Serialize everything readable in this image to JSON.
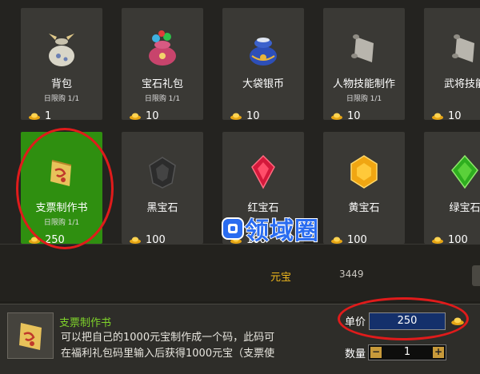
{
  "shop": {
    "items": [
      {
        "name": "背包",
        "limit": "日限购 1/1",
        "price": "1",
        "icon": "bag-icon",
        "selected": false
      },
      {
        "name": "宝石礼包",
        "limit": "日限购 1/1",
        "price": "10",
        "icon": "gem-gift-pack-icon",
        "selected": false
      },
      {
        "name": "大袋银币",
        "limit": "",
        "price": "10",
        "icon": "silver-coin-bag-icon",
        "selected": false
      },
      {
        "name": "人物技能制作",
        "limit": "日限购 1/1",
        "price": "10",
        "icon": "skill-scroll-icon",
        "selected": false
      },
      {
        "name": "武将技能",
        "limit": "",
        "price": "10",
        "icon": "skill-scroll-icon",
        "selected": false
      },
      {
        "name": "支票制作书",
        "limit": "日限购 1/1",
        "price": "250",
        "icon": "check-book-scroll-icon",
        "selected": true
      },
      {
        "name": "黑宝石",
        "limit": "",
        "price": "100",
        "icon": "black-gem-icon",
        "selected": false
      },
      {
        "name": "红宝石",
        "limit": "",
        "price": "100",
        "icon": "red-gem-icon",
        "selected": false
      },
      {
        "name": "黄宝石",
        "limit": "",
        "price": "100",
        "icon": "yellow-gem-icon",
        "selected": false
      },
      {
        "name": "绿宝石",
        "limit": "",
        "price": "100",
        "icon": "green-gem-icon",
        "selected": false
      }
    ]
  },
  "currency": {
    "label": "元宝",
    "value": "3449"
  },
  "detail": {
    "name": "支票制作书",
    "desc_line1": "可以把自己的1000元宝制作成一个码，此码可",
    "desc_line2": "在福利礼包码里输入后获得1000元宝（支票使"
  },
  "purchase": {
    "unit_price_label": "单价",
    "unit_price": "250",
    "quantity_label": "数量",
    "quantity": "1",
    "minus": "−",
    "plus": "+"
  },
  "watermark": {
    "text": "领域圈"
  },
  "colors": {
    "accent_gold": "#f0b81c",
    "selected_green": "#2f8f10",
    "highlight_red": "#e01b1b",
    "name_green": "#7fd32a"
  }
}
